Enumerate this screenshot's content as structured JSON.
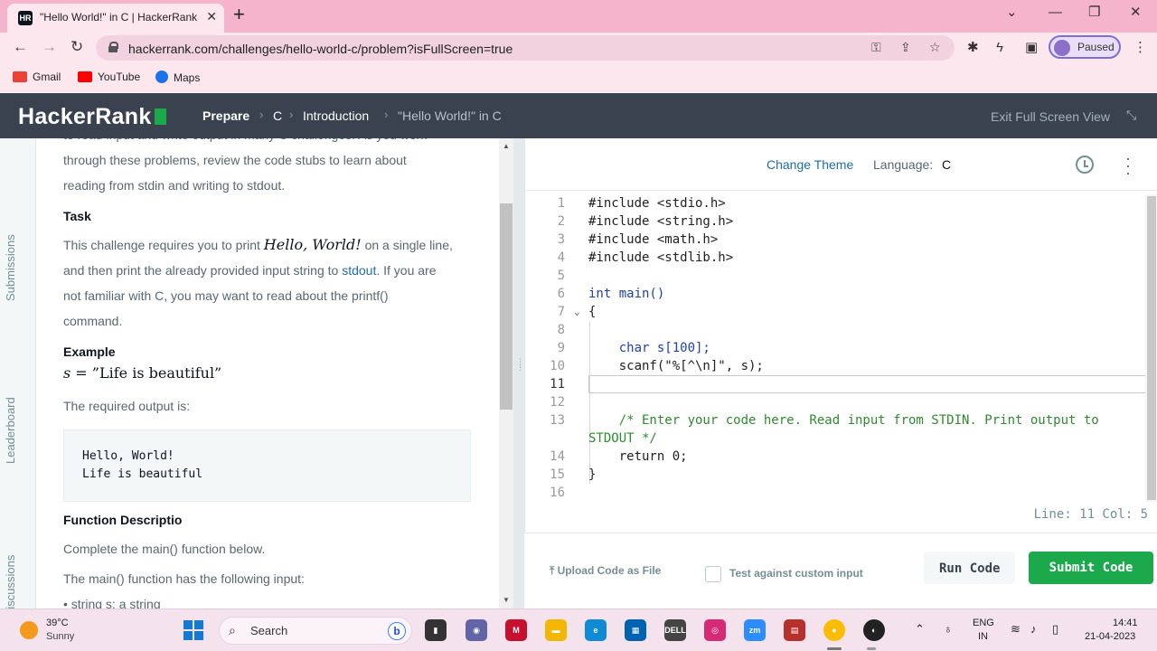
{
  "browser": {
    "tab_title": "\"Hello World!\" in C | HackerRank",
    "tab_favicon_text": "HR",
    "url": "hackerrank.com/challenges/hello-world-c/problem?isFullScreen=true",
    "profile_label": "Paused",
    "bookmarks": [
      "Gmail",
      "YouTube",
      "Maps"
    ]
  },
  "header": {
    "logo": "HackerRank",
    "breadcrumb": [
      "Prepare",
      "C",
      "Introduction",
      "\"Hello World!\" in C"
    ],
    "exit_fullscreen": "Exit Full Screen View"
  },
  "side_tabs": [
    "Submissions",
    "Leaderboard",
    "Discussions"
  ],
  "problem": {
    "intro_line1": "to read input and write output in many C challenges. As you work",
    "intro_line2": "through these problems, review the code stubs to learn about",
    "intro_line3": "reading from stdin and writing to stdout.",
    "task_heading": "Task",
    "task_p1": "This challenge requires you to print ",
    "task_math": "Hello, World!",
    "task_p2": " on a single line,",
    "task_l2a": "and then print the already provided input string to ",
    "task_link": "stdout",
    "task_l2b": ". If you are",
    "task_l3": "not familiar with C, you may want to read about the printf()",
    "task_l4": "command.",
    "example_heading": "Example",
    "example_var": "s",
    "example_eq": " = ",
    "example_value": "”Life is beautiful”",
    "required_output": "The required output is:",
    "sample_output": [
      "Hello, World!",
      "Life is beautiful"
    ],
    "function_heading": "Function Descriptio",
    "function_text": "Complete the main() function below.",
    "input_text": "The main() function has the following input:",
    "input_item": "•  string s: a string"
  },
  "editor": {
    "change_theme": "Change Theme",
    "language_label": "Language:",
    "language_value": "C",
    "lines": [
      {
        "n": "1",
        "code": "#include <stdio.h>"
      },
      {
        "n": "2",
        "code": "#include <string.h>"
      },
      {
        "n": "3",
        "code": "#include <math.h>"
      },
      {
        "n": "4",
        "code": "#include <stdlib.h>"
      },
      {
        "n": "5",
        "code": ""
      },
      {
        "n": "6",
        "code": "int main()"
      },
      {
        "n": "7",
        "code": "{"
      },
      {
        "n": "8",
        "code": ""
      },
      {
        "n": "9",
        "code": "    char s[100];"
      },
      {
        "n": "10",
        "code": "    scanf(\"%[^\\n]\", s);"
      },
      {
        "n": "11",
        "code": ""
      },
      {
        "n": "12",
        "code": ""
      },
      {
        "n": "13",
        "code": "    /* Enter your code here. Read input from STDIN. Print output to"
      },
      {
        "n": "",
        "code": "STDOUT */"
      },
      {
        "n": "14",
        "code": "    return 0;"
      },
      {
        "n": "15",
        "code": "}"
      },
      {
        "n": "16",
        "code": ""
      }
    ],
    "status": "Line: 11 Col: 5"
  },
  "actions": {
    "upload": "Upload Code as File",
    "custom_input": "Test against custom input",
    "run": "Run Code",
    "submit": "Submit Code"
  },
  "taskbar": {
    "temperature": "39°C",
    "condition": "Sunny",
    "search": "Search",
    "lang1": "ENG",
    "lang2": "IN",
    "time": "14:41",
    "date": "21-04-2023"
  },
  "colors": {
    "brand_green": "#1ba94c",
    "header_bg": "#39424e",
    "link_blue": "#1f6ea3",
    "browser_pink": "#f6b3cc"
  }
}
